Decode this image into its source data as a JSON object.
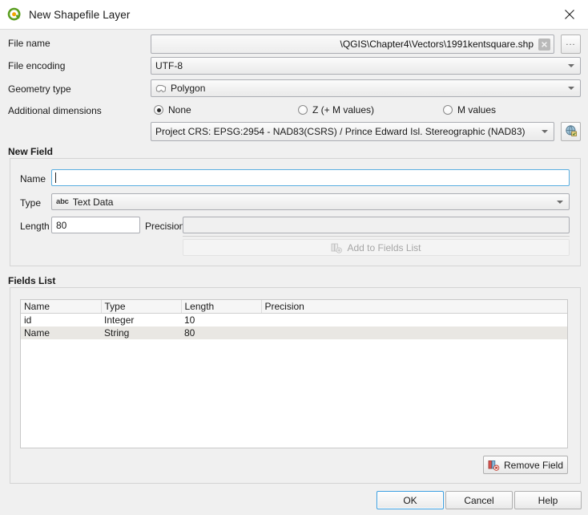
{
  "window": {
    "title": "New Shapefile Layer",
    "app_icon": "qgis-logo-icon",
    "close_icon": "close-icon"
  },
  "form": {
    "file_name": {
      "label": "File name",
      "value": "\\QGIS\\Chapter4\\Vectors\\1991kentsquare.shp",
      "clear_icon": "clear-icon",
      "browse_label": "..."
    },
    "file_encoding": {
      "label": "File encoding",
      "value": "UTF-8"
    },
    "geometry_type": {
      "label": "Geometry type",
      "value": "Polygon",
      "icon": "polygon-icon"
    },
    "additional_dimensions": {
      "label": "Additional dimensions",
      "options": [
        {
          "label": "None",
          "checked": true
        },
        {
          "label": "Z (+ M values)",
          "checked": false
        },
        {
          "label": "M values",
          "checked": false
        }
      ]
    },
    "crs": {
      "value": "Project CRS: EPSG:2954 - NAD83(CSRS) / Prince Edward Isl. Stereographic (NAD83)",
      "select_icon": "crs-globe-icon"
    }
  },
  "new_field": {
    "title": "New Field",
    "name": {
      "label": "Name",
      "value": "",
      "placeholder": ""
    },
    "type": {
      "label": "Type",
      "value": "Text Data",
      "badge": "abc"
    },
    "length": {
      "label": "Length",
      "value": "80"
    },
    "precision": {
      "label": "Precision",
      "value": ""
    },
    "add_button": {
      "label": "Add to Fields List",
      "icon": "add-field-icon",
      "enabled": false
    }
  },
  "fields_list": {
    "title": "Fields List",
    "columns": [
      "Name",
      "Type",
      "Length",
      "Precision"
    ],
    "rows": [
      {
        "name": "id",
        "type": "Integer",
        "length": "10",
        "precision": ""
      },
      {
        "name": "Name",
        "type": "String",
        "length": "80",
        "precision": ""
      }
    ],
    "remove_button": {
      "label": "Remove Field",
      "icon": "remove-field-icon"
    }
  },
  "footer": {
    "ok": "OK",
    "cancel": "Cancel",
    "help": "Help"
  },
  "colors": {
    "accent": "#3c9fe0",
    "window_bg": "#f0f0f0",
    "focus_border": "#5aaee0",
    "alt_row": "#e9e7e3"
  }
}
